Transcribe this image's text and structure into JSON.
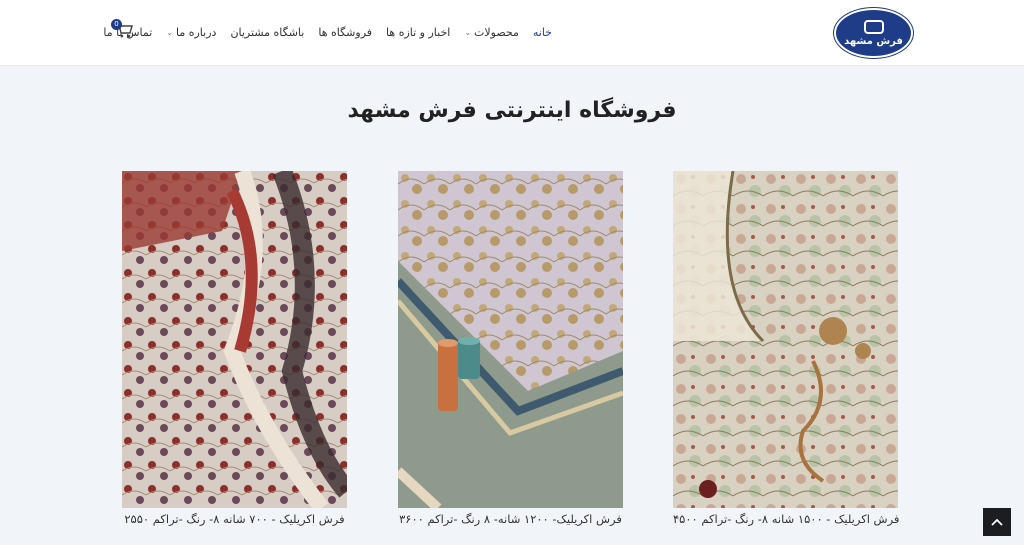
{
  "header": {
    "logo_text": "فرش مشهد",
    "cart_count": "0",
    "nav": [
      {
        "label": "خانه",
        "active": true,
        "dropdown": false
      },
      {
        "label": "محصولات",
        "active": false,
        "dropdown": true
      },
      {
        "label": "اخبار و تازه ها",
        "active": false,
        "dropdown": false
      },
      {
        "label": "فروشگاه ها",
        "active": false,
        "dropdown": false
      },
      {
        "label": "باشگاه مشتریان",
        "active": false,
        "dropdown": false
      },
      {
        "label": "درباره ما",
        "active": false,
        "dropdown": true
      },
      {
        "label": "تماس با ما",
        "active": false,
        "dropdown": false
      }
    ]
  },
  "main": {
    "title": "فروشگاه اینترنتی فرش مشهد",
    "products": [
      {
        "caption": "فرش اکریلیک - ۱۵۰۰ شانه ۸- رنگ -تراکم ۴۵۰۰",
        "image": "rug-photo-cream-floral-with-yarn"
      },
      {
        "caption": "فرش اکریلیک- ۱۲۰۰ شانه- ۸ رنگ -تراکم ۳۶۰۰",
        "image": "rug-photo-lilac-with-thread-spools"
      },
      {
        "caption": "فرش اکریلیک - ۷۰۰ شانه ۸- رنگ -تراکم ۲۵۵۰",
        "image": "rug-photo-red-cream-folded"
      }
    ]
  },
  "scroll_top_icon": "chevron-up-icon",
  "colors": {
    "brand": "#1f3c88",
    "background": "#f1f5f9"
  }
}
